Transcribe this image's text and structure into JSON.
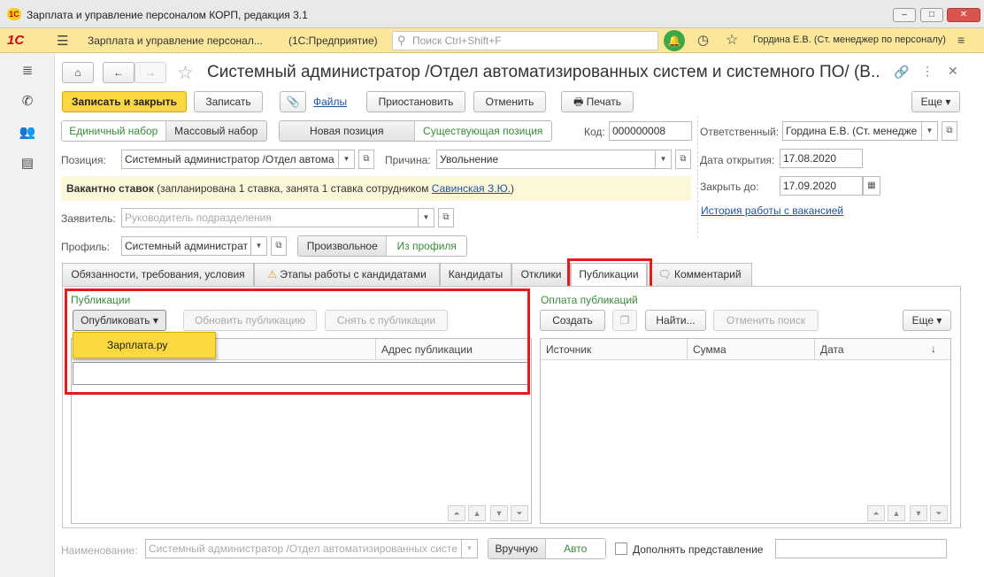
{
  "window": {
    "title": "Зарплата и управление персоналом КОРП, редакция 3.1",
    "logo": "1С"
  },
  "toolbar": {
    "app_name": "Зарплата и управление персонал...",
    "platform": "(1С:Предприятие)",
    "search_placeholder": "Поиск Ctrl+Shift+F",
    "user": "Гордина Е.В. (Ст. менеджер по персоналу)"
  },
  "form": {
    "title": "Системный администратор /Отдел автоматизированных систем и системного ПО/ (В...",
    "save_close": "Записать и закрыть",
    "save": "Записать",
    "files": "Файлы",
    "suspend": "Приостановить",
    "cancel": "Отменить",
    "print": "Печать",
    "more": "Еще",
    "set_single": "Единичный набор",
    "set_mass": "Массовый набор",
    "pos_new": "Новая позиция",
    "pos_existing": "Существующая позиция",
    "code_label": "Код:",
    "code_value": "000000008",
    "responsible_label": "Ответственный:",
    "responsible_value": "Гордина Е.В. (Ст. менедже",
    "position_label": "Позиция:",
    "position_value": "Системный администратор /Отдел автома",
    "reason_label": "Причина:",
    "reason_value": "Увольнение",
    "open_date_label": "Дата открытия:",
    "open_date_value": "17.08.2020",
    "close_by_label": "Закрыть до:",
    "close_by_value": "17.09.2020",
    "history_link": "История работы с вакансией",
    "vacancy_bold": "Вакантно  ставок",
    "vacancy_text": " (запланирована 1 ставка, занята 1 ставка сотрудником ",
    "vacancy_link": "Савинская З.Ю.",
    "vacancy_end": ")",
    "applicant_label": "Заявитель:",
    "applicant_placeholder": "Руководитель подразделения",
    "profile_label": "Профиль:",
    "profile_value": "Системный администрат",
    "profile_free": "Произвольное",
    "profile_from": "Из профиля"
  },
  "tabs": [
    {
      "label": "Обязанности, требования, условия"
    },
    {
      "label": "Этапы работы с кандидатами"
    },
    {
      "label": "Кандидаты"
    },
    {
      "label": "Отклики"
    },
    {
      "label": "Публикации"
    },
    {
      "label": "Комментарий"
    }
  ],
  "publications": {
    "group_title": "Публикации",
    "publish_btn": "Опубликовать",
    "update_btn": "Обновить публикацию",
    "unpublish_btn": "Снять с публикации",
    "col_address": "Адрес публикации",
    "menu_item": "Зарплата.ру"
  },
  "payments": {
    "group_title": "Оплата публикаций",
    "create_btn": "Создать",
    "find_btn": "Найти...",
    "cancel_search_btn": "Отменить поиск",
    "more_btn": "Еще",
    "columns": [
      "Источник",
      "Сумма",
      "Дата"
    ],
    "sort_indicator": "↓"
  },
  "footer": {
    "name_label": "Наименование:",
    "name_value": "Системный администратор /Отдел автоматизированных систе",
    "manual": "Вручную",
    "auto": "Авто",
    "append_label": "Дополнять представление"
  },
  "colors": {
    "accent": "#fbd740",
    "green": "#3a8a3a",
    "highlight": "#e41b1b"
  }
}
